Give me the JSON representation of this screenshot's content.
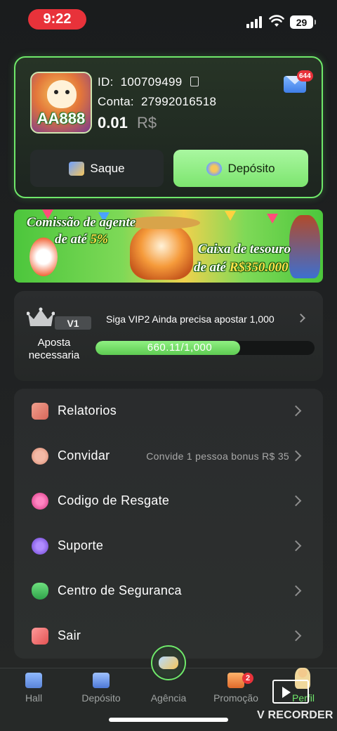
{
  "status_bar": {
    "time": "9:22",
    "battery": "29"
  },
  "account": {
    "avatar_logo": "AA888",
    "id_label": "ID:",
    "id_value": "100709499",
    "conta_label": "Conta:",
    "conta_value": "27992016518",
    "balance": "0.01",
    "currency": "R$",
    "mail_badge": "644",
    "saque_label": "Saque",
    "deposito_label": "Depósito"
  },
  "banner": {
    "line1": "Comissão de agente",
    "line2_prefix": "de até ",
    "line2_value": "5%",
    "line3": "Caixa de tesouro",
    "line4_prefix": "de até ",
    "line4_value": "R$350.000"
  },
  "vip": {
    "level": "V1",
    "aposta_label": "Aposta necessaria",
    "message": "Siga VIP2 Ainda precisa apostar 1,000",
    "progress_text": "660.11/1,000",
    "progress_fraction": 0.66
  },
  "menu": {
    "items": [
      {
        "label": "Relatorios",
        "extra": "",
        "icon": "report-icon",
        "color": "#e98b7a"
      },
      {
        "label": "Convidar",
        "extra": "Convide 1 pessoa bonus R$ 35",
        "icon": "invite-icon",
        "color": "#e9a08a"
      },
      {
        "label": "Codigo de Resgate",
        "extra": "",
        "icon": "gift-code-icon",
        "color": "#e04e9a"
      },
      {
        "label": "Suporte",
        "extra": "",
        "icon": "support-icon",
        "color": "#8a5ae0"
      },
      {
        "label": "Centro de Seguranca",
        "extra": "",
        "icon": "shield-icon",
        "color": "#3fbf5a"
      },
      {
        "label": "Sair",
        "extra": "",
        "icon": "logout-icon",
        "color": "#ef6a6a"
      }
    ]
  },
  "bottom_nav": {
    "items": [
      {
        "label": "Hall",
        "icon": "home-icon"
      },
      {
        "label": "Depósito",
        "icon": "deposit-icon"
      },
      {
        "label": "Agência",
        "icon": "agency-icon"
      },
      {
        "label": "Promoção",
        "icon": "promo-icon",
        "badge": "2"
      },
      {
        "label": "Perfil",
        "icon": "profile-icon"
      }
    ]
  },
  "watermark": {
    "text": "V RECORDER"
  },
  "colors": {
    "accent_green": "#6fe86a",
    "badge_red": "#e8323a"
  }
}
